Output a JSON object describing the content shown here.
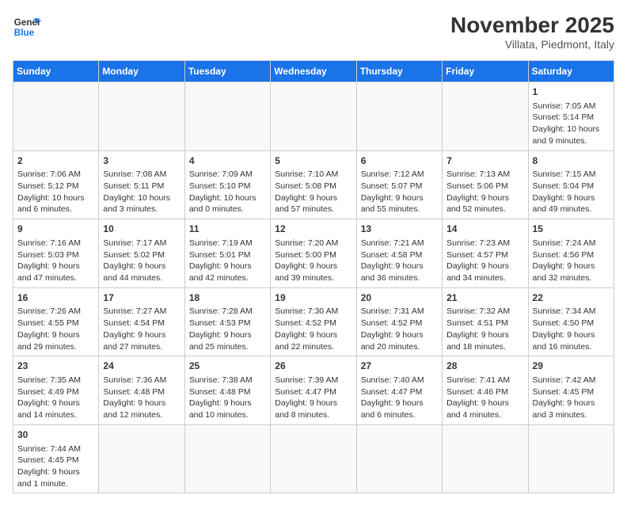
{
  "header": {
    "logo_line1": "General",
    "logo_line2": "Blue",
    "month_title": "November 2025",
    "location": "Villata, Piedmont, Italy"
  },
  "days_of_week": [
    "Sunday",
    "Monday",
    "Tuesday",
    "Wednesday",
    "Thursday",
    "Friday",
    "Saturday"
  ],
  "weeks": [
    [
      {
        "day": "",
        "content": ""
      },
      {
        "day": "",
        "content": ""
      },
      {
        "day": "",
        "content": ""
      },
      {
        "day": "",
        "content": ""
      },
      {
        "day": "",
        "content": ""
      },
      {
        "day": "",
        "content": ""
      },
      {
        "day": "1",
        "content": "Sunrise: 7:05 AM\nSunset: 5:14 PM\nDaylight: 10 hours\nand 9 minutes."
      }
    ],
    [
      {
        "day": "2",
        "content": "Sunrise: 7:06 AM\nSunset: 5:12 PM\nDaylight: 10 hours\nand 6 minutes."
      },
      {
        "day": "3",
        "content": "Sunrise: 7:08 AM\nSunset: 5:11 PM\nDaylight: 10 hours\nand 3 minutes."
      },
      {
        "day": "4",
        "content": "Sunrise: 7:09 AM\nSunset: 5:10 PM\nDaylight: 10 hours\nand 0 minutes."
      },
      {
        "day": "5",
        "content": "Sunrise: 7:10 AM\nSunset: 5:08 PM\nDaylight: 9 hours\nand 57 minutes."
      },
      {
        "day": "6",
        "content": "Sunrise: 7:12 AM\nSunset: 5:07 PM\nDaylight: 9 hours\nand 55 minutes."
      },
      {
        "day": "7",
        "content": "Sunrise: 7:13 AM\nSunset: 5:06 PM\nDaylight: 9 hours\nand 52 minutes."
      },
      {
        "day": "8",
        "content": "Sunrise: 7:15 AM\nSunset: 5:04 PM\nDaylight: 9 hours\nand 49 minutes."
      }
    ],
    [
      {
        "day": "9",
        "content": "Sunrise: 7:16 AM\nSunset: 5:03 PM\nDaylight: 9 hours\nand 47 minutes."
      },
      {
        "day": "10",
        "content": "Sunrise: 7:17 AM\nSunset: 5:02 PM\nDaylight: 9 hours\nand 44 minutes."
      },
      {
        "day": "11",
        "content": "Sunrise: 7:19 AM\nSunset: 5:01 PM\nDaylight: 9 hours\nand 42 minutes."
      },
      {
        "day": "12",
        "content": "Sunrise: 7:20 AM\nSunset: 5:00 PM\nDaylight: 9 hours\nand 39 minutes."
      },
      {
        "day": "13",
        "content": "Sunrise: 7:21 AM\nSunset: 4:58 PM\nDaylight: 9 hours\nand 36 minutes."
      },
      {
        "day": "14",
        "content": "Sunrise: 7:23 AM\nSunset: 4:57 PM\nDaylight: 9 hours\nand 34 minutes."
      },
      {
        "day": "15",
        "content": "Sunrise: 7:24 AM\nSunset: 4:56 PM\nDaylight: 9 hours\nand 32 minutes."
      }
    ],
    [
      {
        "day": "16",
        "content": "Sunrise: 7:26 AM\nSunset: 4:55 PM\nDaylight: 9 hours\nand 29 minutes."
      },
      {
        "day": "17",
        "content": "Sunrise: 7:27 AM\nSunset: 4:54 PM\nDaylight: 9 hours\nand 27 minutes."
      },
      {
        "day": "18",
        "content": "Sunrise: 7:28 AM\nSunset: 4:53 PM\nDaylight: 9 hours\nand 25 minutes."
      },
      {
        "day": "19",
        "content": "Sunrise: 7:30 AM\nSunset: 4:52 PM\nDaylight: 9 hours\nand 22 minutes."
      },
      {
        "day": "20",
        "content": "Sunrise: 7:31 AM\nSunset: 4:52 PM\nDaylight: 9 hours\nand 20 minutes."
      },
      {
        "day": "21",
        "content": "Sunrise: 7:32 AM\nSunset: 4:51 PM\nDaylight: 9 hours\nand 18 minutes."
      },
      {
        "day": "22",
        "content": "Sunrise: 7:34 AM\nSunset: 4:50 PM\nDaylight: 9 hours\nand 16 minutes."
      }
    ],
    [
      {
        "day": "23",
        "content": "Sunrise: 7:35 AM\nSunset: 4:49 PM\nDaylight: 9 hours\nand 14 minutes."
      },
      {
        "day": "24",
        "content": "Sunrise: 7:36 AM\nSunset: 4:48 PM\nDaylight: 9 hours\nand 12 minutes."
      },
      {
        "day": "25",
        "content": "Sunrise: 7:38 AM\nSunset: 4:48 PM\nDaylight: 9 hours\nand 10 minutes."
      },
      {
        "day": "26",
        "content": "Sunrise: 7:39 AM\nSunset: 4:47 PM\nDaylight: 9 hours\nand 8 minutes."
      },
      {
        "day": "27",
        "content": "Sunrise: 7:40 AM\nSunset: 4:47 PM\nDaylight: 9 hours\nand 6 minutes."
      },
      {
        "day": "28",
        "content": "Sunrise: 7:41 AM\nSunset: 4:46 PM\nDaylight: 9 hours\nand 4 minutes."
      },
      {
        "day": "29",
        "content": "Sunrise: 7:42 AM\nSunset: 4:45 PM\nDaylight: 9 hours\nand 3 minutes."
      }
    ],
    [
      {
        "day": "30",
        "content": "Sunrise: 7:44 AM\nSunset: 4:45 PM\nDaylight: 9 hours\nand 1 minute."
      },
      {
        "day": "",
        "content": ""
      },
      {
        "day": "",
        "content": ""
      },
      {
        "day": "",
        "content": ""
      },
      {
        "day": "",
        "content": ""
      },
      {
        "day": "",
        "content": ""
      },
      {
        "day": "",
        "content": ""
      }
    ]
  ]
}
